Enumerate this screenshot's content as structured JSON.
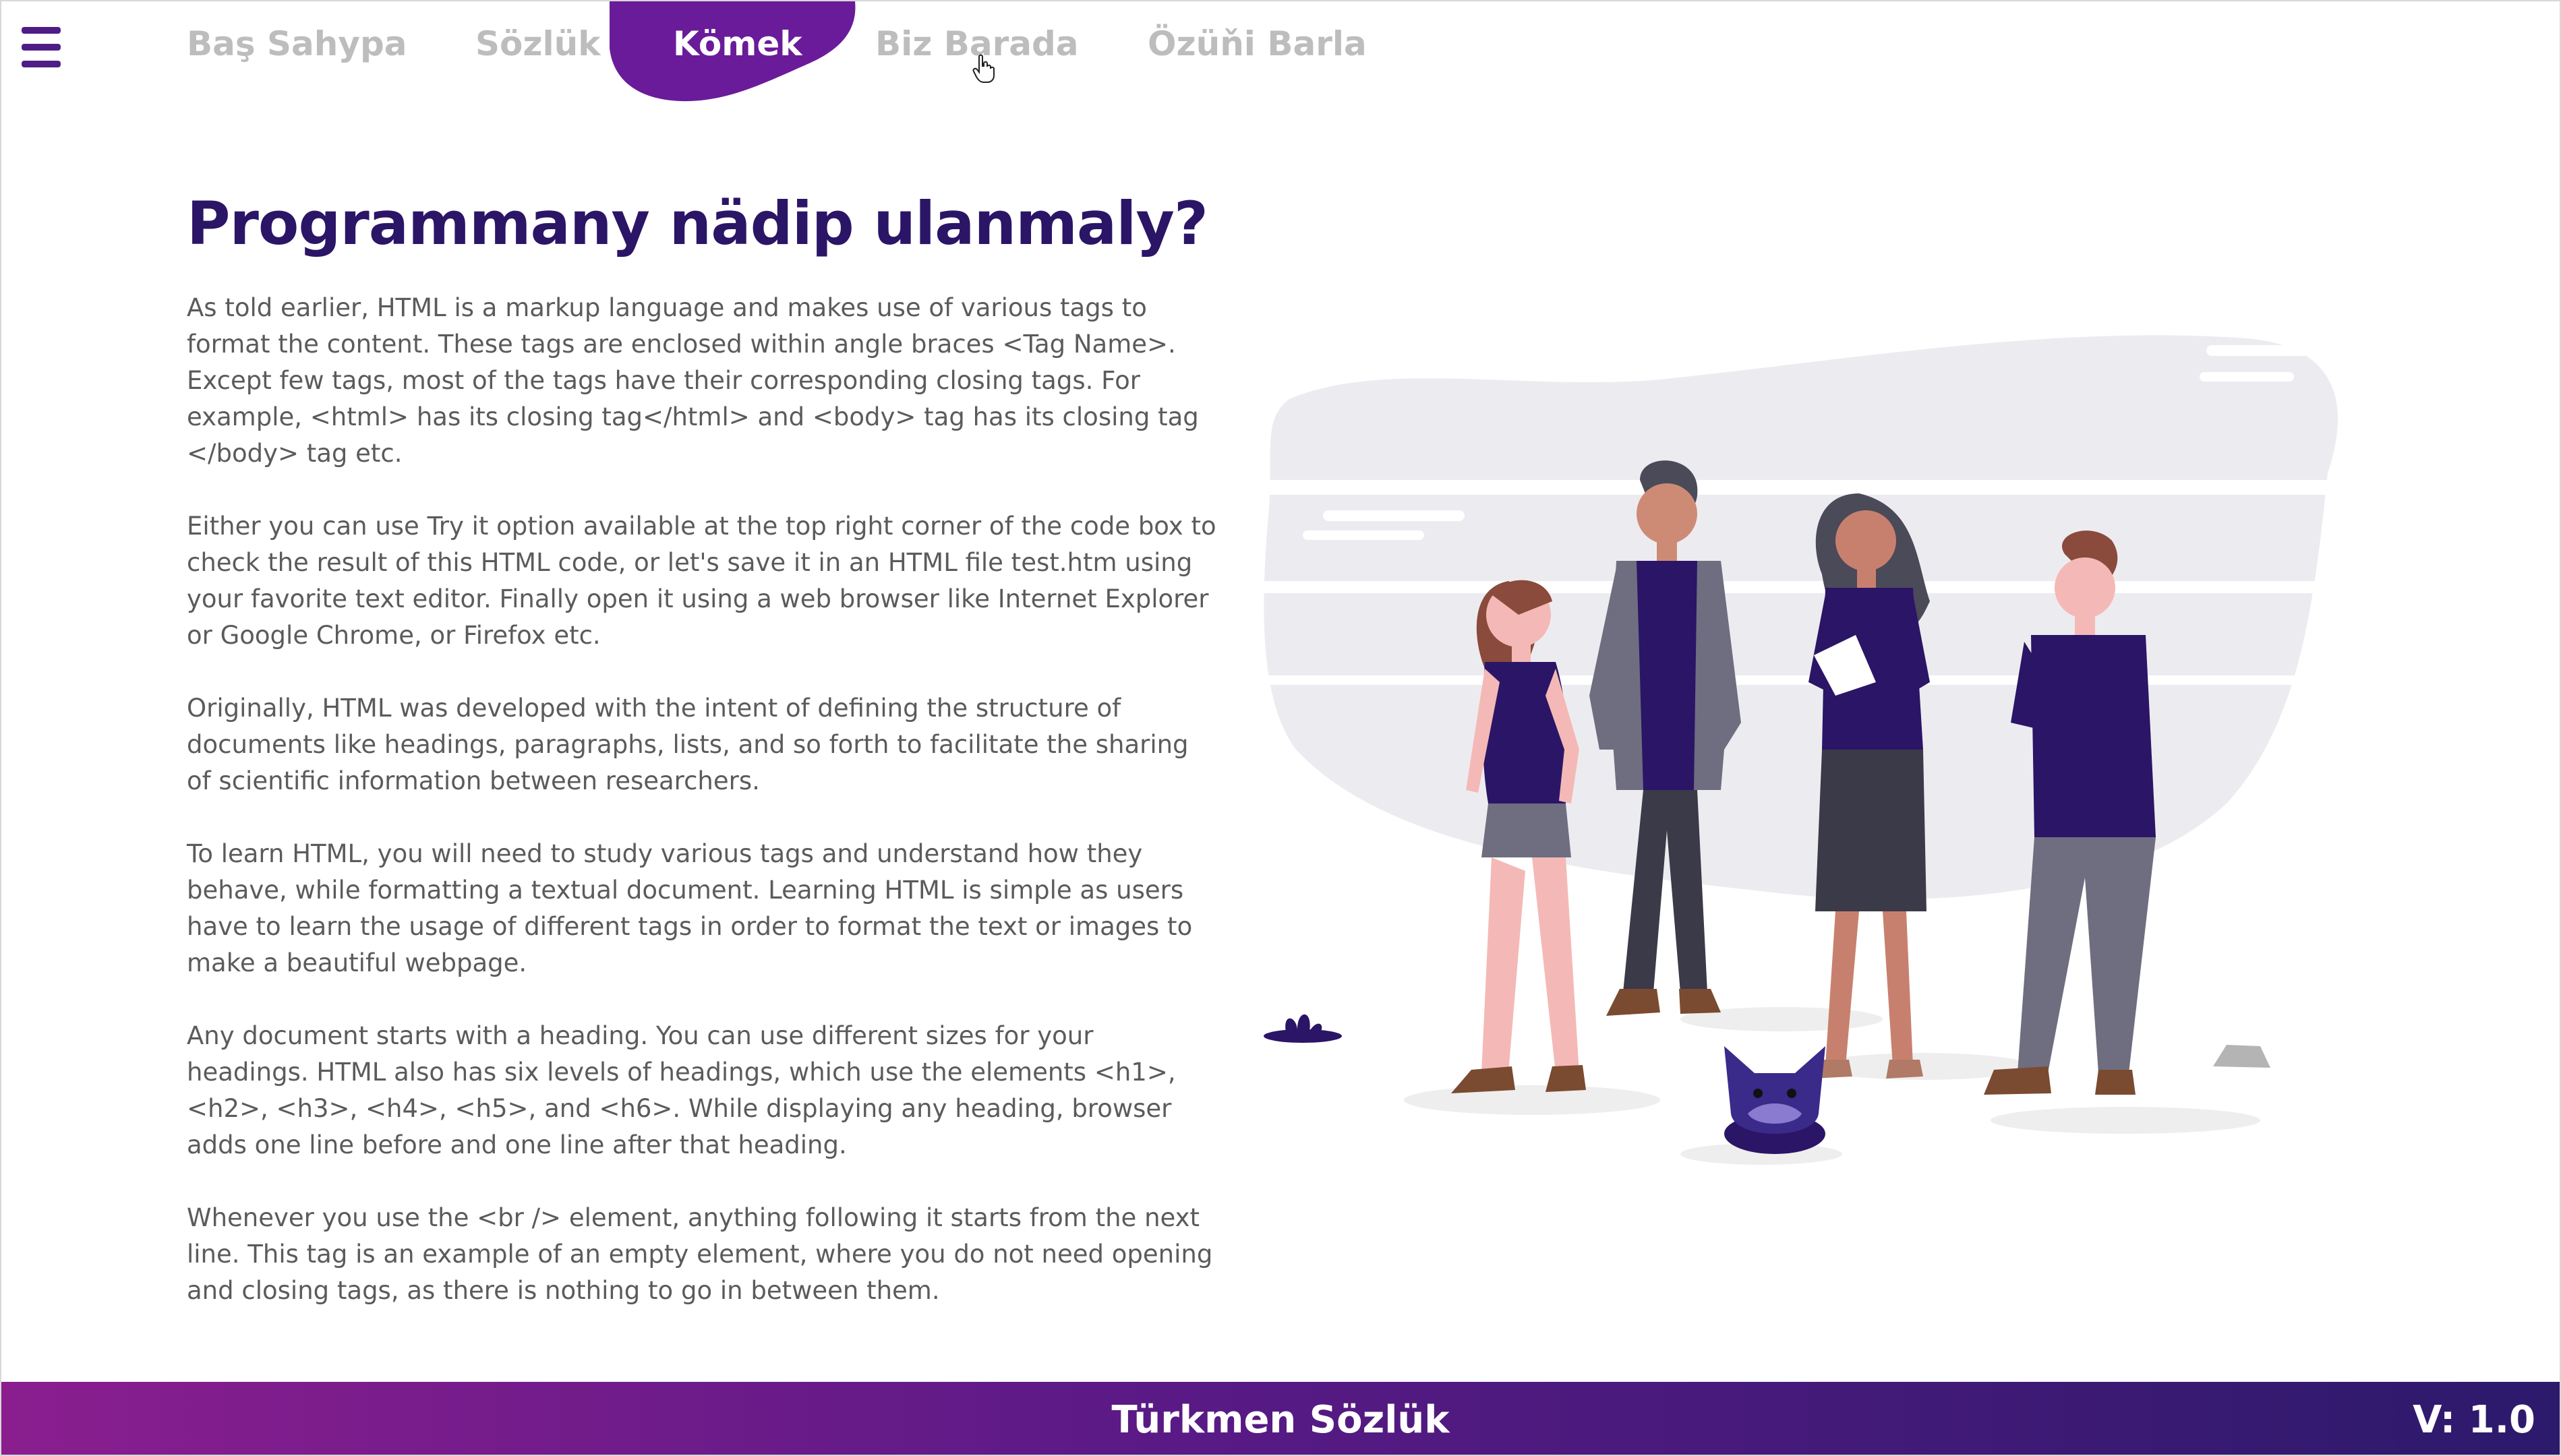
{
  "nav": {
    "tabs": [
      {
        "label": "Baş Sahypa",
        "active": false
      },
      {
        "label": "Sözlük",
        "active": false
      },
      {
        "label": "Kömek",
        "active": true
      },
      {
        "label": "Biz Barada",
        "active": false
      },
      {
        "label": "Özüňi Barla",
        "active": false
      }
    ],
    "menu_icon": "hamburger-menu-icon"
  },
  "main": {
    "title": "Programmany nädip ulanmaly?",
    "paragraphs": [
      "As told earlier, HTML is a markup language and makes use of various tags to format the content. These tags are enclosed within angle braces <Tag Name>. Except few tags, most of the tags have their corresponding closing tags. For example, <html> has its closing tag</html> and <body> tag has its closing tag </body> tag etc.",
      "Either you can use Try it option available at the top right corner of the code box to check the result of this HTML code, or let's save it in an HTML file test.htm using your favorite text editor. Finally open it using a web browser like Internet Explorer or Google Chrome, or Firefox etc.",
      "Originally, HTML was developed with the intent of defining the structure of documents like headings, paragraphs, lists, and so forth to facilitate the sharing of scientific information between researchers.",
      "To learn HTML, you will need to study various tags and understand how they behave, while formatting a textual document. Learning HTML is simple as users have to learn the usage of different tags in order to format the text or images to make a beautiful webpage.",
      "Any document starts with a heading. You can use different sizes for your headings. HTML also has six levels of headings, which use the elements <h1>, <h2>, <h3>, <h4>, <h5>, and <h6>. While displaying any heading, browser adds one line before and one line after that heading.",
      "Whenever you use the <br /> element, anything following it starts from the next line. This tag is an example of an empty element, where you do not need opening and closing tags, as there is nothing to go in between them."
    ]
  },
  "footer": {
    "title": "Türkmen Sözlük",
    "version": "V: 1.0"
  },
  "colors": {
    "primary": "#4e1d86",
    "title": "#2b1566",
    "footer_start": "#8a1e8f",
    "footer_end": "#2c1a6b",
    "inactive_tab": "#bdbdbd"
  }
}
